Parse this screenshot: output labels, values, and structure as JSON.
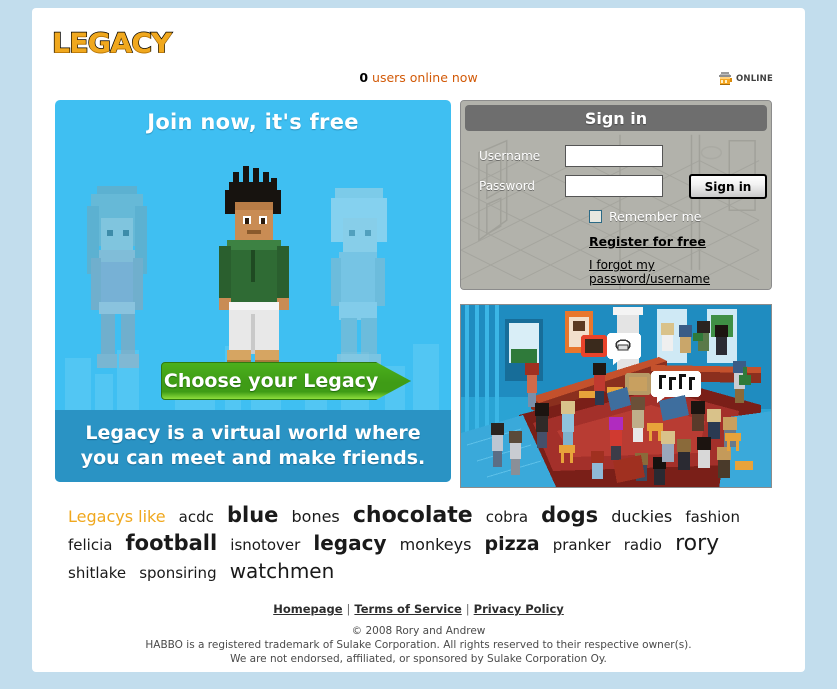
{
  "site": {
    "logo_text": "LEGACY",
    "logo_color": "#f0a81e"
  },
  "status": {
    "users_online_count": "0",
    "users_online_label": "users online now",
    "badge_text": "ONLINE",
    "badge_icon": "mug-online-icon"
  },
  "promo": {
    "headline": "Join now, it's free",
    "cta_label": "Choose your Legacy",
    "tagline": "Legacy is a virtual world where you can meet and make friends.",
    "bg_color": "#3fbff2",
    "tagline_bg": "#2a93c4",
    "cta_color": "#3f9c16"
  },
  "signin": {
    "title": "Sign in",
    "username_label": "Username",
    "username_value": "",
    "username_placeholder": "",
    "password_label": "Password",
    "password_value": "",
    "password_placeholder": "",
    "submit_label": "Sign in",
    "remember_label": "Remember me",
    "remember_checked": false,
    "register_link": "Register for free",
    "forgot_link": "I forgot my password/username"
  },
  "tags": {
    "heading": "Legacys like",
    "items": [
      {
        "label": "acdc",
        "size": 15,
        "weight": "normal"
      },
      {
        "label": "blue",
        "size": 21,
        "weight": "bold"
      },
      {
        "label": "bones",
        "size": 16,
        "weight": "normal"
      },
      {
        "label": "chocolate",
        "size": 22,
        "weight": "bold"
      },
      {
        "label": "cobra",
        "size": 15,
        "weight": "normal"
      },
      {
        "label": "dogs",
        "size": 21,
        "weight": "bold"
      },
      {
        "label": "duckies",
        "size": 16,
        "weight": "normal"
      },
      {
        "label": "fashion",
        "size": 15,
        "weight": "normal"
      },
      {
        "label": "felicia",
        "size": 15,
        "weight": "normal"
      },
      {
        "label": "football",
        "size": 21,
        "weight": "bold"
      },
      {
        "label": "isnotover",
        "size": 15,
        "weight": "normal"
      },
      {
        "label": "legacy",
        "size": 20,
        "weight": "bold"
      },
      {
        "label": "monkeys",
        "size": 16,
        "weight": "normal"
      },
      {
        "label": "pizza",
        "size": 19,
        "weight": "bold"
      },
      {
        "label": "pranker",
        "size": 15,
        "weight": "normal"
      },
      {
        "label": "radio",
        "size": 15,
        "weight": "normal"
      },
      {
        "label": "rory",
        "size": 22,
        "weight": "normal"
      },
      {
        "label": "shitlake",
        "size": 15,
        "weight": "normal"
      },
      {
        "label": "sponsiring",
        "size": 15,
        "weight": "normal"
      },
      {
        "label": "watchmen",
        "size": 20,
        "weight": "normal"
      }
    ]
  },
  "footer": {
    "links": [
      "Homepage",
      "Terms of Service",
      "Privacy Policy"
    ],
    "separator": "|",
    "copyright": "© 2008 Rory and Andrew",
    "trademark": "HABBO is a registered trademark of Sulake Corporation. All rights reserved to their respective owner(s).",
    "disclaimer": "We are not endorsed, affiliated, or sponsored by Sulake Corporation Oy."
  }
}
